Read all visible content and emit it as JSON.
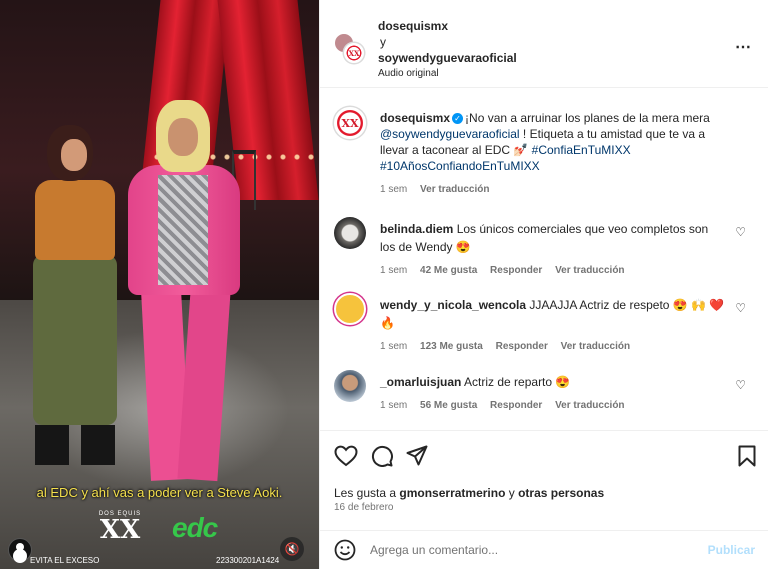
{
  "video": {
    "subtitle": "al EDC y ahí vas a poder ver a Steve Aoki.",
    "logo_small": "DOS EQUIS",
    "logo_big": "XX",
    "logo_edc": "edc",
    "footer_left": "EVITA EL EXCESO",
    "footer_code": "223300201A1424",
    "mute_icon": "muted-speaker-icon"
  },
  "header": {
    "author": "dosequismx",
    "conjunction": "y",
    "coauthor": "soywendyguevaraoficial",
    "audio": "Audio original",
    "more_icon": "⋯"
  },
  "caption": {
    "username": "dosequismx",
    "text_1": "¡No van a arruinar los planes de la mera mera ",
    "mention": "@soywendyguevaraoficial",
    "text_2": " ! Etiqueta a tu amistad que te va a llevar a taconear al EDC 💅🏻 ",
    "hashtag_1": "#ConfiaEnTuMIXX",
    "hashtag_2": "#10AñosConfiandoEnTuMIXX",
    "time": "1 sem",
    "translate": "Ver traducción"
  },
  "comments": [
    {
      "username": "belinda.diem",
      "text": "Los únicos comerciales que veo completos son los de Wendy",
      "emoji": "😍",
      "time": "1 sem",
      "likes": "42 Me gusta",
      "reply": "Responder",
      "translate": "Ver traducción"
    },
    {
      "username": "wendy_y_nicola_wencola",
      "text": "JJAAJJA Actriz de respeto",
      "emoji": "😍 🙌 ❤️ 🔥",
      "time": "1 sem",
      "likes": "123 Me gusta",
      "reply": "Responder",
      "translate": "Ver traducción"
    },
    {
      "username": "_omarluisjuan",
      "text": "Actriz de reparto",
      "emoji": "😍",
      "time": "1 sem",
      "likes": "56 Me gusta",
      "reply": "Responder",
      "translate": "Ver traducción"
    }
  ],
  "actions": {
    "likes_prefix": "Les gusta a ",
    "likes_user": "gmonserratmerino",
    "likes_suffix": " y ",
    "likes_others": "otras personas",
    "date": "16 de febrero"
  },
  "composer": {
    "placeholder": "Agrega un comentario...",
    "post_label": "Publicar"
  },
  "colors": {
    "accent_link": "#00376b",
    "verified": "#0095f6",
    "brand_red": "#e3192c",
    "subtitle_yellow": "#f4e04d"
  }
}
